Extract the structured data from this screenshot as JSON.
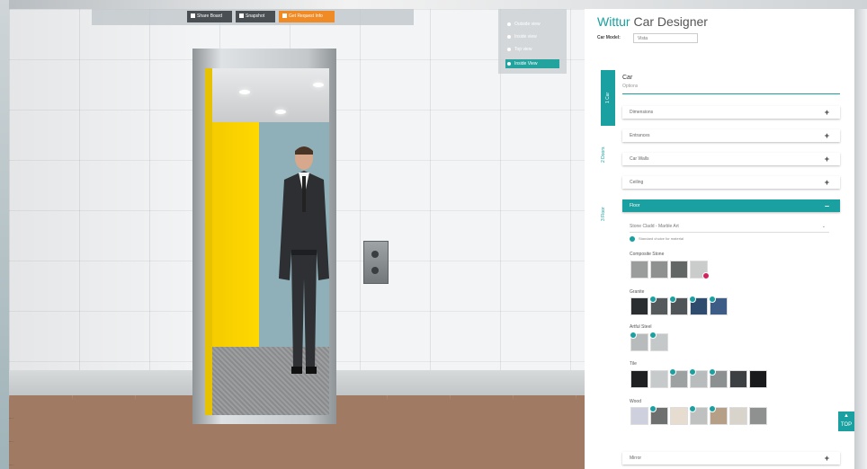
{
  "toolbar": {
    "share_label": "Share Board",
    "snapshot_label": "Snapshot",
    "request_label": "Get Request Info"
  },
  "views": {
    "items": [
      {
        "label": "Outside view"
      },
      {
        "label": "Inside view"
      },
      {
        "label": "Top view"
      },
      {
        "label": "Inside View"
      }
    ],
    "active_index": 3
  },
  "panel": {
    "brand": "Wittur",
    "title_rest": " Car Designer",
    "car_model_label": "Car Model:",
    "car_model_value": "Vista",
    "steps": [
      "1 Car",
      "2 Doors",
      "3 Floor"
    ],
    "section_title": "Car",
    "section_subtitle": "Options",
    "accordions": [
      {
        "label": "Dimensions"
      },
      {
        "label": "Entrances"
      },
      {
        "label": "Car Walls"
      },
      {
        "label": "Ceiling"
      },
      {
        "label": "Floor"
      }
    ],
    "floor_material": "Stone Cladd - Marble Art",
    "radio_label": "Standard choice for material",
    "groups": [
      {
        "label": "Composite Stone"
      },
      {
        "label": "Granite"
      },
      {
        "label": "Artful Steel"
      },
      {
        "label": "Tile"
      },
      {
        "label": "Wood"
      }
    ],
    "mirror_label": "Mirror",
    "scroll_top_label": "TOP"
  },
  "colors": {
    "accent": "#1aa0a0",
    "cabin_yellow": "#ffd800",
    "floor_brown": "#a07a63",
    "toolbar_orange": "#f08a24",
    "toolbar_dark": "#4a4f53"
  }
}
